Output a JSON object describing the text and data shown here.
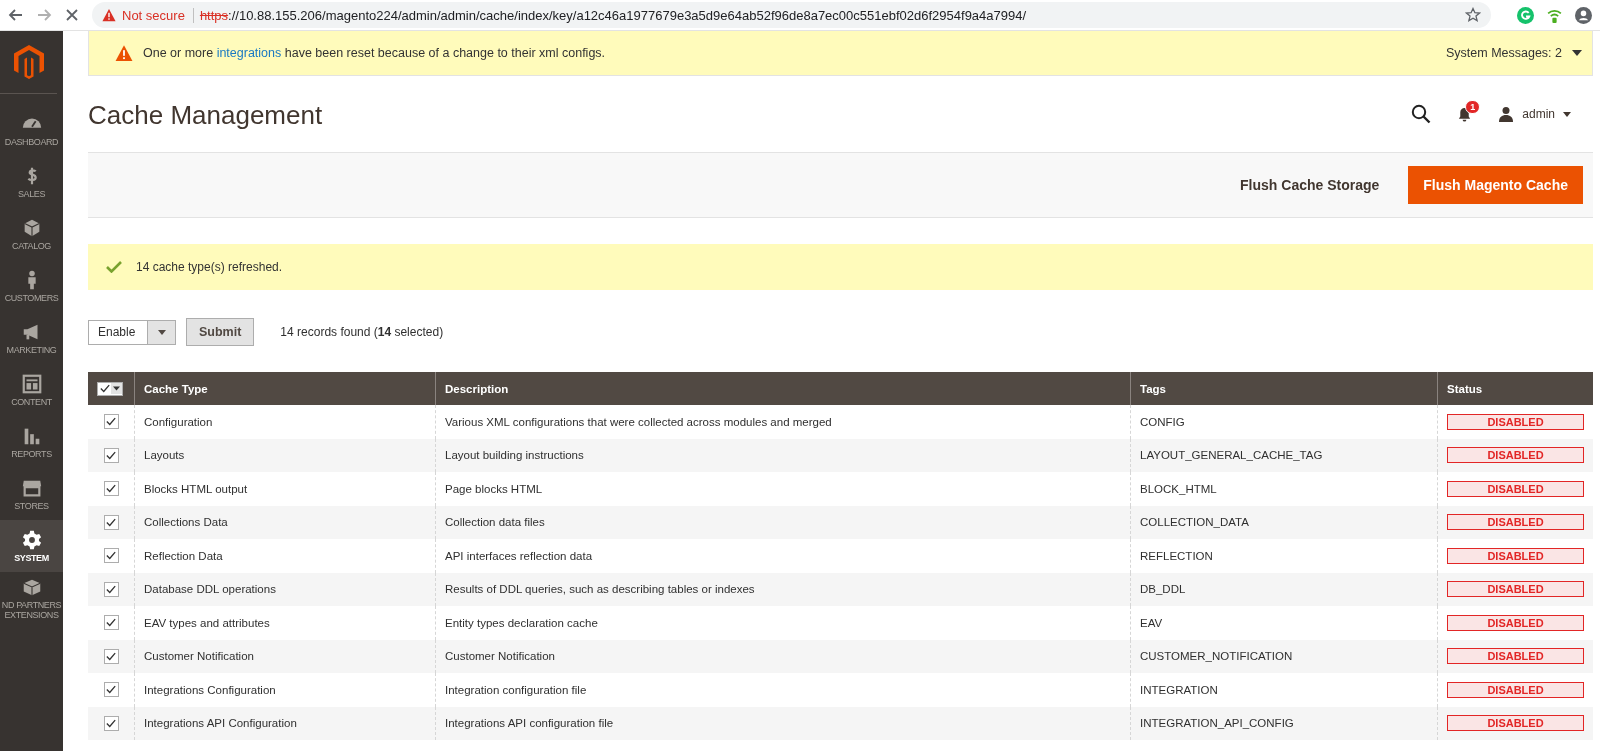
{
  "browser": {
    "security": "Not secure",
    "url_scheme": "https",
    "url_rest": "://10.88.155.206/magento224/admin/admin/cache/index/key/a12c46a1977679e3a5d9e64ab52f96de8a7ec00c551ebf02d6f2954f9a4a7994/"
  },
  "system_message": {
    "before": "One or more ",
    "link": "integrations",
    "after": " have been reset because of a change to their xml configs.",
    "count_label": "System Messages: 2"
  },
  "sidebar": {
    "items": [
      {
        "label": "DASHBOARD",
        "selected": false
      },
      {
        "label": "SALES",
        "selected": false
      },
      {
        "label": "CATALOG",
        "selected": false
      },
      {
        "label": "CUSTOMERS",
        "selected": false
      },
      {
        "label": "MARKETING",
        "selected": false
      },
      {
        "label": "CONTENT",
        "selected": false
      },
      {
        "label": "REPORTS",
        "selected": false
      },
      {
        "label": "STORES",
        "selected": false
      },
      {
        "label": "SYSTEM",
        "selected": true
      },
      {
        "label": "ND PARTNERS EXTENSIONS",
        "selected": false
      }
    ]
  },
  "header": {
    "title": "Cache Management",
    "notifications": "1",
    "user": "admin"
  },
  "actions": [
    {
      "label": "Flush Cache Storage",
      "kind": "secondary"
    },
    {
      "label": "Flush Magento Cache",
      "kind": "primary"
    }
  ],
  "message": {
    "text": "14 cache type(s) refreshed."
  },
  "toolbar": {
    "action": "Enable",
    "submit": "Submit",
    "records": "14 records found (**14** selected)"
  },
  "table": {
    "all_checked": true,
    "columns": [
      "Cache Type",
      "Description",
      "Tags",
      "Status"
    ],
    "rows": [
      {
        "checked": true,
        "cache_type": "Configuration",
        "description": "Various XML configurations that were collected across modules and merged",
        "tags": "CONFIG",
        "status": "DISABLED",
        "enabled": false
      },
      {
        "checked": true,
        "cache_type": "Layouts",
        "description": "Layout building instructions",
        "tags": "LAYOUT_GENERAL_CACHE_TAG",
        "status": "DISABLED",
        "enabled": false
      },
      {
        "checked": true,
        "cache_type": "Blocks HTML output",
        "description": "Page blocks HTML",
        "tags": "BLOCK_HTML",
        "status": "DISABLED",
        "enabled": false
      },
      {
        "checked": true,
        "cache_type": "Collections Data",
        "description": "Collection data files",
        "tags": "COLLECTION_DATA",
        "status": "DISABLED",
        "enabled": false
      },
      {
        "checked": true,
        "cache_type": "Reflection Data",
        "description": "API interfaces reflection data",
        "tags": "REFLECTION",
        "status": "DISABLED",
        "enabled": false
      },
      {
        "checked": true,
        "cache_type": "Database DDL operations",
        "description": "Results of DDL queries, such as describing tables or indexes",
        "tags": "DB_DDL",
        "status": "DISABLED",
        "enabled": false
      },
      {
        "checked": true,
        "cache_type": "EAV types and attributes",
        "description": "Entity types declaration cache",
        "tags": "EAV",
        "status": "DISABLED",
        "enabled": false
      },
      {
        "checked": true,
        "cache_type": "Customer Notification",
        "description": "Customer Notification",
        "tags": "CUSTOMER_NOTIFICATION",
        "status": "DISABLED",
        "enabled": false
      },
      {
        "checked": true,
        "cache_type": "Integrations Configuration",
        "description": "Integration configuration file",
        "tags": "INTEGRATION",
        "status": "DISABLED",
        "enabled": false
      },
      {
        "checked": true,
        "cache_type": "Integrations API Configuration",
        "description": "Integrations API configuration file",
        "tags": "INTEGRATION_API_CONFIG",
        "status": "DISABLED",
        "enabled": false
      }
    ]
  }
}
